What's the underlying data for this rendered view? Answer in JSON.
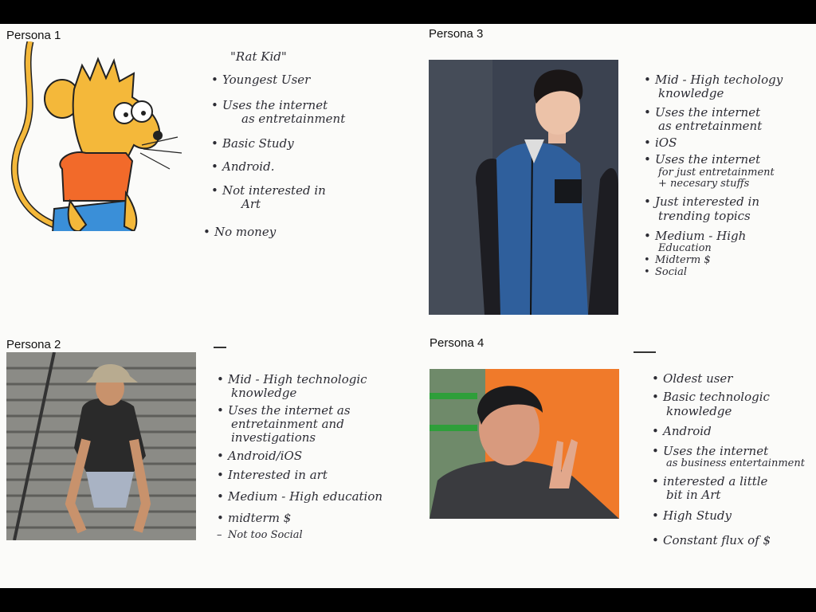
{
  "personas": [
    {
      "title": "Persona 1",
      "nickname": "\"Rat Kid\"",
      "bullets": [
        "Youngest User",
        "Uses the internet",
        "as entretainment",
        "Basic Study",
        "Android.",
        "Not interested in",
        "Art",
        "No money"
      ]
    },
    {
      "title": "Persona 2",
      "bullets": [
        "Mid - High technologic",
        "knowledge",
        "Uses the internet as",
        "entretainment and",
        "investigations",
        "Android/iOS",
        "Interested in art",
        "Medium - High education",
        "midterm $",
        "Not too Social"
      ]
    },
    {
      "title": "Persona 3",
      "bullets": [
        "Mid - High techology",
        "knowledge",
        "Uses the internet",
        "as entretainment",
        "iOS",
        "Uses the internet",
        "for just entretainment",
        "+ necesary stuffs",
        "Just interested in",
        "trending topics",
        "Medium - High",
        "Education",
        "Midterm $",
        "Social"
      ]
    },
    {
      "title": "Persona 4",
      "bullets": [
        "Oldest user",
        "Basic technologic",
        "knowledge",
        "Android",
        "Uses the internet",
        "as business entertainment",
        "interested a little",
        "bit in Art",
        "High Study",
        "Constant flux of $"
      ]
    }
  ],
  "colors": {
    "paper": "#fbfbf9",
    "ink": "#2c2c34",
    "rat_fur": "#f4b83a",
    "shirt_orange": "#f26a2a",
    "shorts_blue": "#3a8fd8",
    "jacket_blue": "#2f5f9c",
    "backdrop_orange": "#f07a2a"
  }
}
